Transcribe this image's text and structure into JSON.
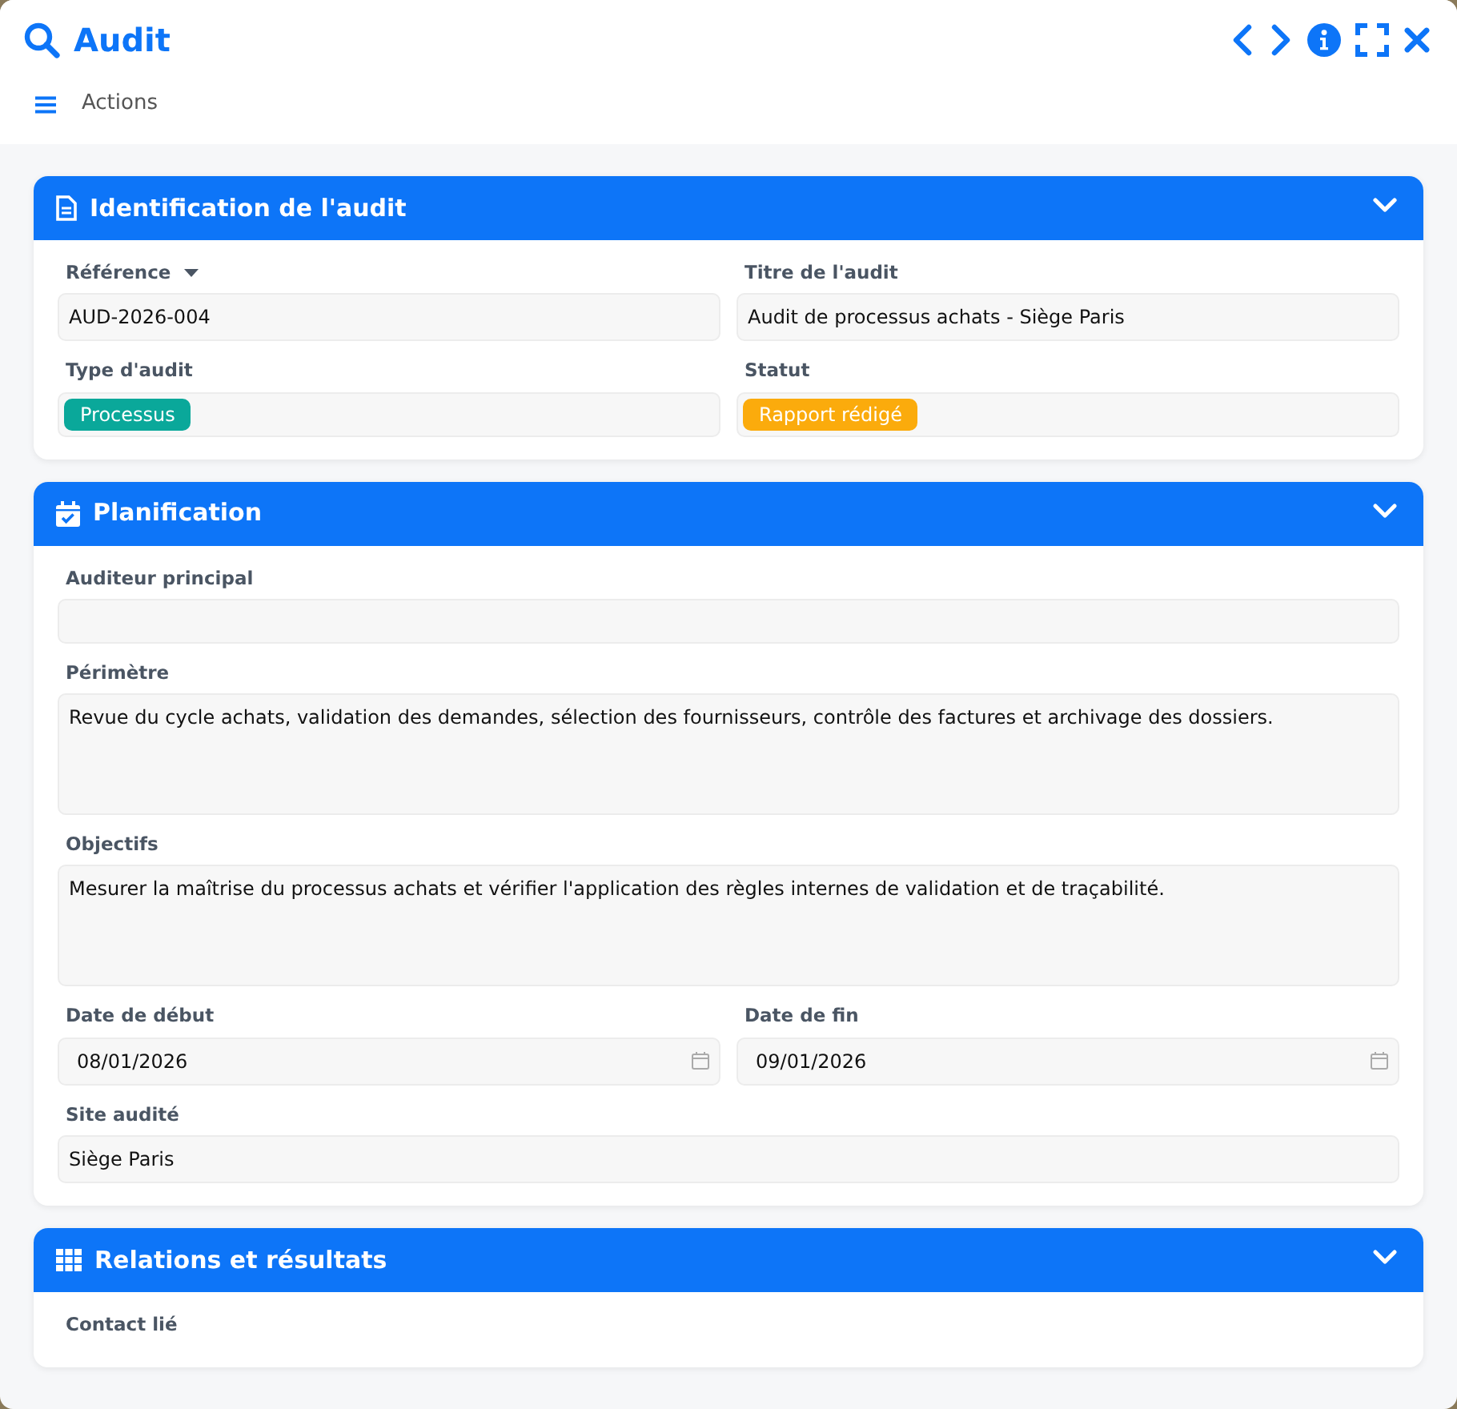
{
  "window": {
    "title": "Audit"
  },
  "toolbar": {
    "menu_label": "Actions"
  },
  "sections": [
    {
      "title": "Identification de l'audit",
      "expanded": true,
      "rows": [
        [
          {
            "label": "Référence",
            "kind": "text",
            "dropdown": true,
            "value": "AUD-2026-004"
          },
          {
            "label": "Titre de l'audit",
            "kind": "text",
            "value": "Audit de processus achats - Siège Paris"
          }
        ],
        [
          {
            "label": "Type d'audit",
            "kind": "badge",
            "value": "Processus",
            "color": "#0aa89a"
          },
          {
            "label": "Statut",
            "kind": "badge",
            "value": "Rapport rédigé",
            "color": "#fbab0c"
          }
        ]
      ]
    },
    {
      "title": "Planification",
      "expanded": true,
      "rows": [
        [
          {
            "label": "Auditeur principal",
            "kind": "text"
          }
        ],
        [
          {
            "label": "Périmètre",
            "kind": "textarea",
            "value": "Revue du cycle achats, validation des demandes, sélection des fournisseurs, contrôle des factures et archivage des dossiers."
          }
        ],
        [
          {
            "label": "Objectifs",
            "kind": "textarea",
            "value": "Mesurer la maîtrise du processus achats et vérifier l'application des règles internes de validation et de traçabilité."
          }
        ],
        [
          {
            "label": "Date de début",
            "kind": "date",
            "value": "08/01/2026"
          },
          {
            "label": "Date de fin",
            "kind": "date",
            "value": "09/01/2026"
          }
        ],
        [
          {
            "label": "Site audité",
            "kind": "text",
            "value": "Siège Paris"
          }
        ]
      ]
    },
    {
      "title": "Relations et résultats",
      "expanded": true,
      "rows": [
        [
          {
            "label": "Contact lié",
            "kind": "label_only"
          }
        ]
      ]
    }
  ]
}
